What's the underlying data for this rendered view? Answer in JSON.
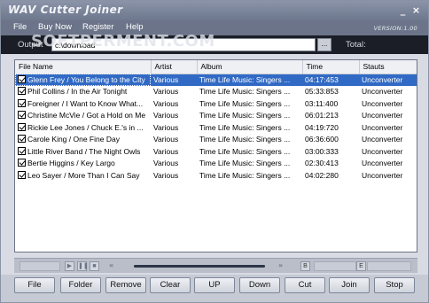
{
  "window": {
    "title": "WAV Cutter Joiner",
    "controls": {
      "minimize": "_",
      "close": "×"
    }
  },
  "menu": {
    "items": [
      "File",
      "Buy Now",
      "Register",
      "Help"
    ],
    "version": "VERSION:1.00"
  },
  "output": {
    "label": "Output",
    "value": "c:\\download",
    "browse_label": "...",
    "total_label": "Total:"
  },
  "watermark": "SOFTPERMENT.COM",
  "file_list": {
    "columns": [
      "File Name",
      "Artist",
      "Album",
      "Time",
      "Stauts"
    ],
    "rows": [
      {
        "file": "Glenn Frey / You Belong to the City",
        "artist": "Various",
        "album": "Time Life Music:  Singers ...",
        "time": "04:17:453",
        "status": "Unconverter",
        "selected": true
      },
      {
        "file": "Phil Collins / In the Air Tonight",
        "artist": "Various",
        "album": "Time Life Music:  Singers ...",
        "time": "05:33:853",
        "status": "Unconverter",
        "selected": false
      },
      {
        "file": "Foreigner / I Want to Know What...",
        "artist": "Various",
        "album": "Time Life Music:  Singers ...",
        "time": "03:11:400",
        "status": "Unconverter",
        "selected": false
      },
      {
        "file": "Christine McVie / Got a Hold on Me",
        "artist": "Various",
        "album": "Time Life Music:  Singers ...",
        "time": "06:01:213",
        "status": "Unconverter",
        "selected": false
      },
      {
        "file": "Rickie Lee Jones / Chuck E.'s in ...",
        "artist": "Various",
        "album": "Time Life Music:  Singers ...",
        "time": "04:19:720",
        "status": "Unconverter",
        "selected": false
      },
      {
        "file": "Carole King / One Fine Day",
        "artist": "Various",
        "album": "Time Life Music:  Singers ...",
        "time": "06:36:600",
        "status": "Unconverter",
        "selected": false
      },
      {
        "file": "Little River Band / The Night Owls",
        "artist": "Various",
        "album": "Time Life Music:  Singers ...",
        "time": "03:00:333",
        "status": "Unconverter",
        "selected": false
      },
      {
        "file": "Bertie Higgins / Key Largo",
        "artist": "Various",
        "album": "Time Life Music:  Singers ...",
        "time": "02:30:413",
        "status": "Unconverter",
        "selected": false
      },
      {
        "file": "Leo Sayer / More Than I Can Say",
        "artist": "Various",
        "album": "Time Life Music:  Singers ...",
        "time": "04:02:280",
        "status": "Unconverter",
        "selected": false
      }
    ]
  },
  "transport": {
    "play_icon": "▶",
    "pause_icon": "❚❚",
    "stop_icon": "■",
    "rewind_icon": "«",
    "forward_icon": "»",
    "begin_marker": "B",
    "end_marker": "E",
    "progress": 1.0
  },
  "buttons": [
    "File",
    "Folder",
    "Remove",
    "Clear",
    "UP",
    "Down",
    "Cut",
    "Join",
    "Stop"
  ],
  "colors": {
    "selection": "#316ac5",
    "titlebar": "#7c859a",
    "menubar": "#6b7489",
    "output_bar": "#1b1e26"
  }
}
